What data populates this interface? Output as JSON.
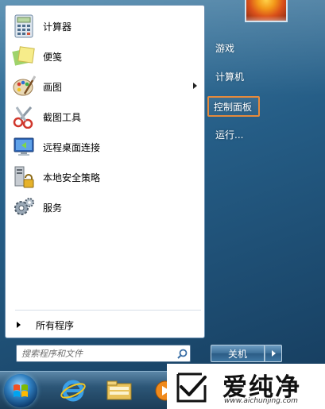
{
  "start_menu": {
    "programs": [
      {
        "label": "计算器",
        "icon": "calculator-icon"
      },
      {
        "label": "便笺",
        "icon": "sticky-notes-icon"
      },
      {
        "label": "画图",
        "icon": "paint-icon",
        "has_submenu": true
      },
      {
        "label": "截图工具",
        "icon": "snipping-tool-icon"
      },
      {
        "label": "远程桌面连接",
        "icon": "remote-desktop-icon"
      },
      {
        "label": "本地安全策略",
        "icon": "security-policy-icon"
      },
      {
        "label": "服务",
        "icon": "services-icon"
      }
    ],
    "all_programs_label": "所有程序",
    "search": {
      "placeholder": "搜索程序和文件",
      "value": ""
    },
    "right_links": [
      {
        "label": "游戏"
      },
      {
        "label": "计算机"
      },
      {
        "label": "控制面板",
        "highlighted": true
      },
      {
        "label": "运行..."
      }
    ],
    "shutdown_label": "关机",
    "highlight_color": "#e58a3c"
  },
  "taskbar": {
    "items": [
      "start-orb-icon",
      "internet-explorer-icon",
      "file-explorer-icon",
      "media-player-icon"
    ]
  },
  "watermark": {
    "title": "爱纯净",
    "url": "www.aichunjing.com"
  }
}
